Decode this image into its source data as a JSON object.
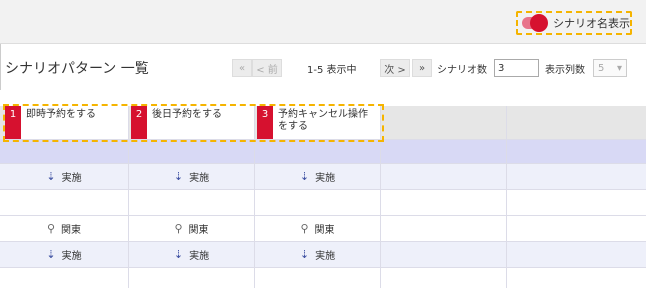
{
  "toggle": {
    "label": "シナリオ名表示",
    "on": true
  },
  "title": "シナリオパターン 一覧",
  "pager": {
    "first": "«",
    "prev": "< 前",
    "range": "1-5 表示中",
    "next": "次 >",
    "last": "»",
    "scenario_count_label": "シナリオ数",
    "scenario_count_value": "3",
    "cols_label": "表示列数",
    "cols_value": "5"
  },
  "patterns": [
    {
      "num": "1",
      "name": "即時予約をする"
    },
    {
      "num": "2",
      "name": "後日予約をする"
    },
    {
      "num": "3",
      "name": "予約キャンセル操作をする"
    }
  ],
  "rows": {
    "execute_label": "実施",
    "region_label": "関東"
  },
  "colors": {
    "accent": "#d6112f",
    "highlight": "#f5b400",
    "section": "#d8d9f5"
  }
}
